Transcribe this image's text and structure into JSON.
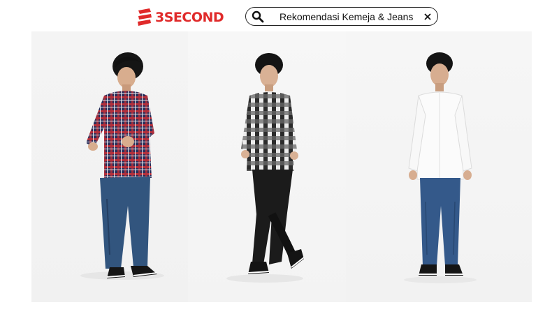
{
  "brand": {
    "name": "3SECOND",
    "color": "#e02a2a"
  },
  "search": {
    "query": "Rekomendasi Kemeja & Jeans",
    "icon": "search-icon",
    "clear_icon": "close-icon"
  },
  "gallery": {
    "items": [
      {
        "shirt": "red-navy-plaid-flannel",
        "pants": "blue-jeans",
        "shoes": "black-sneakers"
      },
      {
        "shirt": "black-white-check-shirt",
        "pants": "black-trousers",
        "shoes": "black-sneakers"
      },
      {
        "shirt": "white-mandarin-collar-shirt",
        "pants": "blue-jeans",
        "shoes": "black-sneakers"
      }
    ]
  }
}
